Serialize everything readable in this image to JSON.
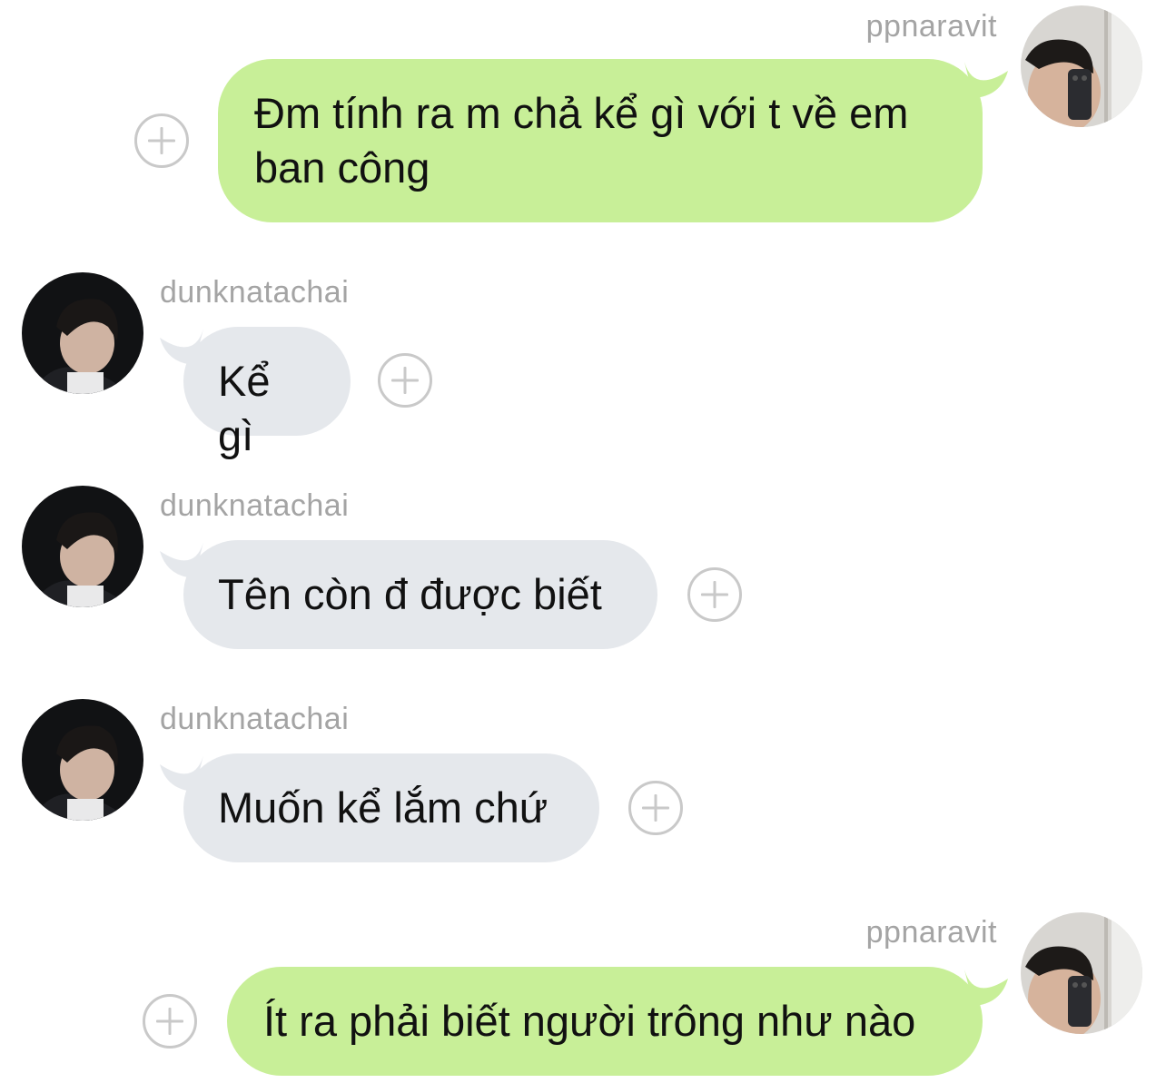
{
  "messages": [
    {
      "sender": "ppnaravit",
      "direction": "out",
      "text": "Đm tính ra m chả kể gì với t về em ban công"
    },
    {
      "sender": "dunknatachai",
      "direction": "in",
      "text": "Kể gì"
    },
    {
      "sender": "dunknatachai",
      "direction": "in",
      "text": "Tên còn đ được biết"
    },
    {
      "sender": "dunknatachai",
      "direction": "in",
      "text": "Muốn kể lắm chứ"
    },
    {
      "sender": "ppnaravit",
      "direction": "out",
      "text": "Ít ra phải biết người trông như nào"
    }
  ],
  "colors": {
    "outgoing_bubble": "#c8ef98",
    "incoming_bubble": "#e5e8ec",
    "username": "#a4a4a4",
    "add_reaction_icon": "#c9c9c9"
  },
  "icons": {
    "add_reaction": "plus-circle-icon",
    "avatar": "profile-photo"
  }
}
